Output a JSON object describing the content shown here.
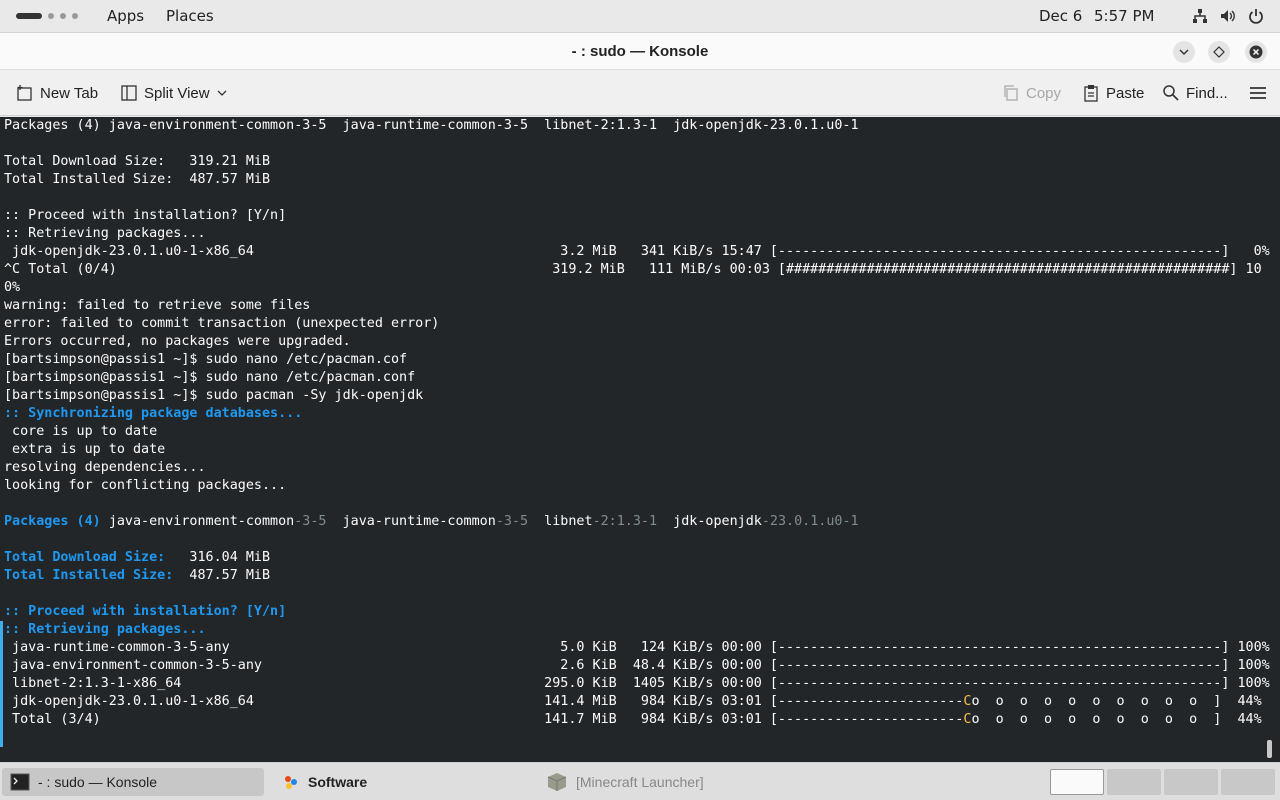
{
  "topbar": {
    "apps": "Apps",
    "places": "Places",
    "date": "Dec 6",
    "time": "5:57 PM",
    "tray_icons": [
      "network-icon",
      "volume-icon",
      "power-icon"
    ]
  },
  "window": {
    "title": "- : sudo — Konsole"
  },
  "toolbar": {
    "new_tab": "New Tab",
    "split_view": "Split View",
    "copy": "Copy",
    "paste": "Paste",
    "find": "Find..."
  },
  "terminal": {
    "lines": [
      [
        {
          "t": "Packages (4) java-environment-common-3-5  java-runtime-common-3-5  libnet-2:1.3-1  jdk-openjdk-23.0.1.u0-1"
        }
      ],
      [
        {
          "t": ""
        }
      ],
      [
        {
          "t": "Total Download Size:   319.21 MiB"
        }
      ],
      [
        {
          "t": "Total Installed Size:  487.57 MiB"
        }
      ],
      [
        {
          "t": ""
        }
      ],
      [
        {
          "t": ":: Proceed with installation? [Y/n]"
        }
      ],
      [
        {
          "t": ":: Retrieving packages..."
        }
      ],
      [
        {
          "t": " jdk-openjdk-23.0.1.u0-1-x86_64                                      3.2 MiB   341 KiB/s 15:47 [-------------------------------------------------------]   0%"
        }
      ],
      [
        {
          "t": "^C Total (0/4)                                                      319.2 MiB   111 MiB/s 00:03 [#######################################################] 10"
        }
      ],
      [
        {
          "t": "0%"
        }
      ],
      [
        {
          "t": "warning: failed to retrieve some files"
        }
      ],
      [
        {
          "t": "error: failed to commit transaction (unexpected error)"
        }
      ],
      [
        {
          "t": "Errors occurred, no packages were upgraded."
        }
      ],
      [
        {
          "t": "[bartsimpson@passis1 ~]$ sudo nano /etc/pacman.cof"
        }
      ],
      [
        {
          "t": "[bartsimpson@passis1 ~]$ sudo nano /etc/pacman.conf"
        }
      ],
      [
        {
          "t": "[bartsimpson@passis1 ~]$ sudo pacman -Sy jdk-openjdk"
        }
      ],
      [
        {
          "t": ":: Synchronizing package databases...",
          "c": "cyan"
        }
      ],
      [
        {
          "t": " core is up to date"
        }
      ],
      [
        {
          "t": " extra is up to date"
        }
      ],
      [
        {
          "t": "resolving dependencies..."
        }
      ],
      [
        {
          "t": "looking for conflicting packages..."
        }
      ],
      [
        {
          "t": ""
        }
      ],
      [
        {
          "t": "Packages (4) ",
          "c": "cyan"
        },
        {
          "t": "java-environment-common"
        },
        {
          "t": "-3-5",
          "c": "dim"
        },
        {
          "t": "  java-runtime-common"
        },
        {
          "t": "-3-5",
          "c": "dim"
        },
        {
          "t": "  libnet"
        },
        {
          "t": "-2:1.3-1",
          "c": "dim"
        },
        {
          "t": "  jdk-openjdk"
        },
        {
          "t": "-23.0.1.u0-1",
          "c": "dim"
        }
      ],
      [
        {
          "t": ""
        }
      ],
      [
        {
          "t": "Total Download Size:",
          "c": "cyan"
        },
        {
          "t": "   316.04 MiB"
        }
      ],
      [
        {
          "t": "Total Installed Size:",
          "c": "cyan"
        },
        {
          "t": "  487.57 MiB"
        }
      ],
      [
        {
          "t": ""
        }
      ],
      [
        {
          "t": ":: Proceed with installation? [Y/n]",
          "c": "cyan"
        }
      ],
      [
        {
          "t": ":: Retrieving packages...",
          "c": "cyan"
        }
      ],
      [
        {
          "t": " java-runtime-common-3-5-any                                         5.0 KiB   124 KiB/s 00:00 [-------------------------------------------------------] 100%"
        }
      ],
      [
        {
          "t": " java-environment-common-3-5-any                                     2.6 KiB  48.4 KiB/s 00:00 [-------------------------------------------------------] 100%"
        }
      ],
      [
        {
          "t": " libnet-2:1.3-1-x86_64                                             295.0 KiB  1405 KiB/s 00:00 [-------------------------------------------------------] 100%"
        }
      ],
      [
        {
          "t": " jdk-openjdk-23.0.1.u0-1-x86_64                                    141.4 MiB   984 KiB/s 03:01 [-----------------------"
        },
        {
          "t": "C",
          "c": "orange"
        },
        {
          "t": "o  o  o  o  o  o  o  o  o  o  ]  44%"
        }
      ],
      [
        {
          "t": " Total (3/4)                                                       141.7 MiB   984 KiB/s 03:01 [-----------------------"
        },
        {
          "t": "C",
          "c": "orange"
        },
        {
          "t": "o  o  o  o  o  o  o  o  o  o  ]  44%"
        }
      ]
    ]
  },
  "taskbar": {
    "tasks": [
      {
        "label": "- : sudo — Konsole",
        "icon": "terminal-icon",
        "active": true
      },
      {
        "label": "Software",
        "icon": "software-icon",
        "active": false
      },
      {
        "label": "[Minecraft Launcher]",
        "icon": "minecraft-icon",
        "active": false
      }
    ],
    "workspaces": 4
  },
  "colors": {
    "terminal_bg": "#232629",
    "terminal_fg": "#fcfcfc",
    "accent_cyan": "#1d99f3",
    "dim": "#7f8c8d",
    "orange": "#fdbc4b"
  }
}
